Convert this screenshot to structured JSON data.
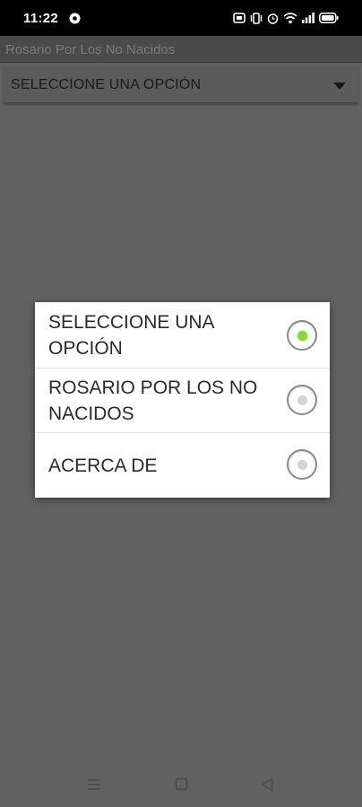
{
  "status_bar": {
    "time": "11:22",
    "icons": [
      "chrome-icon",
      "nfc-icon",
      "vibrate-icon",
      "alarm-icon",
      "wifi-icon",
      "signal-icon",
      "battery-icon"
    ]
  },
  "app": {
    "title": "Rosario Por Los No Nacidos"
  },
  "spinner": {
    "selected_label": "SELECCIONE UNA OPCIÓN"
  },
  "dialog": {
    "options": [
      {
        "label": "SELECCIONE UNA OPCIÓN",
        "checked": true
      },
      {
        "label": "ROSARIO POR LOS NO NACIDOS",
        "checked": false
      },
      {
        "label": "ACERCA DE",
        "checked": false
      }
    ]
  },
  "colors": {
    "radio_checked": "#8bd53a",
    "overlay": "#616161"
  },
  "nav_bar": {
    "buttons": [
      "menu-icon",
      "home-icon",
      "back-icon"
    ]
  }
}
